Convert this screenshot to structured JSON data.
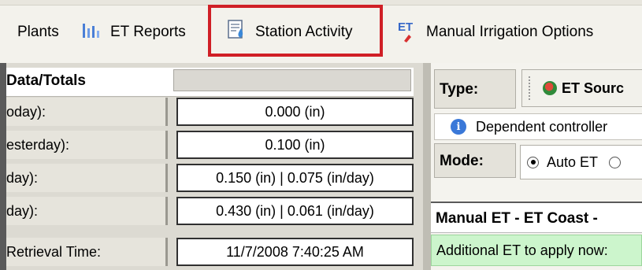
{
  "toolbar": {
    "items": [
      {
        "label": "Plants",
        "icon": "plants"
      },
      {
        "label": "ET Reports",
        "icon": "bar-chart-icon"
      },
      {
        "label": "Station Activity",
        "icon": "station-activity-icon"
      },
      {
        "label": "Manual Irrigation Options",
        "icon": "et-icon"
      }
    ],
    "et_icon_text": "ET",
    "highlight_color": "#d01f26"
  },
  "left_panel": {
    "header": "Data/Totals",
    "rows": [
      {
        "label": "oday):",
        "value": "0.000 (in)"
      },
      {
        "label": "esterday):",
        "value": "0.100 (in)"
      },
      {
        "label": " day):",
        "value": "0.150 (in) | 0.075 (in/day)"
      },
      {
        "label": " day):",
        "value": "0.430 (in) | 0.061 (in/day)"
      },
      {
        "label": "Retrieval Time:",
        "value": "11/7/2008 7:40:25 AM"
      }
    ]
  },
  "right_panel": {
    "type_label": "Type:",
    "type_value": "ET Sourc",
    "info_text": "Dependent controller",
    "mode_label": "Mode:",
    "mode_option": "Auto ET",
    "section_title": "Manual ET - ET Coast -",
    "additional_text": "Additional  ET to apply now:"
  }
}
